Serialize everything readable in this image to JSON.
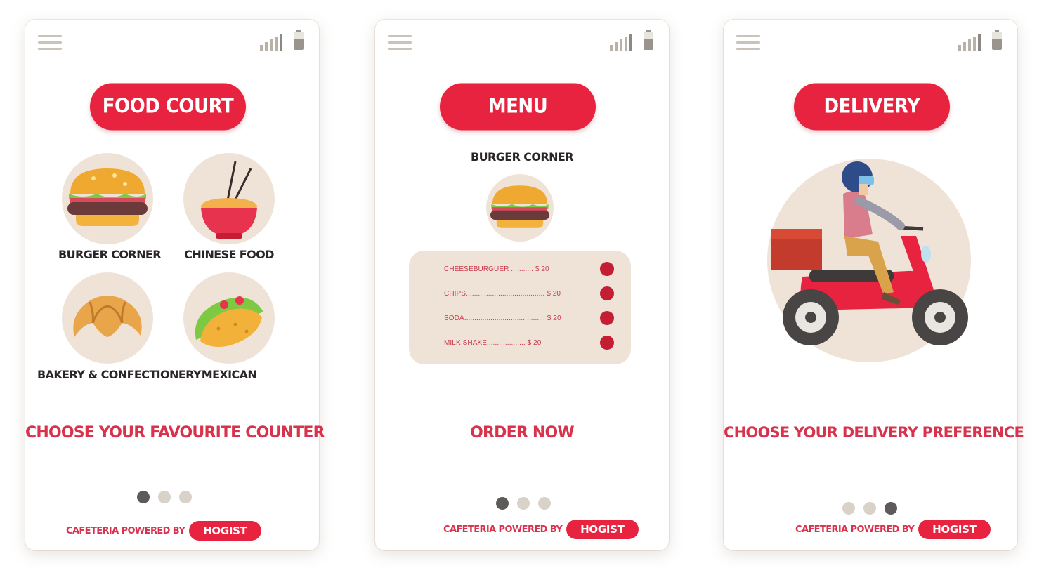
{
  "screens": [
    {
      "title": "FOOD COURT",
      "counters": [
        {
          "label": "BURGER CORNER",
          "icon": "burger-icon"
        },
        {
          "label": "CHINESE FOOD",
          "icon": "noodle-bowl-icon"
        },
        {
          "label": "BAKERY & CONFECTIONERY",
          "icon": "croissant-icon"
        },
        {
          "label": "MEXICAN",
          "icon": "taco-icon"
        }
      ],
      "tagline": "CHOOSE YOUR FAVOURITE COUNTER",
      "active_dot": 1
    },
    {
      "title": "MENU",
      "counter_name": "BURGER CORNER",
      "menu_items": [
        {
          "name": "CHEESEBURGUER",
          "leader": "CHEESEBURGUER ........... $ 20"
        },
        {
          "name": "CHIPS",
          "leader": "CHIPS....................................... $ 20"
        },
        {
          "name": "SODA",
          "leader": "SODA........................................ $ 20"
        },
        {
          "name": "MILK SHAKE",
          "leader": "MILK SHAKE................... $ 20"
        }
      ],
      "tagline": "ORDER NOW",
      "active_dot": 1
    },
    {
      "title": "DELIVERY",
      "tagline": "CHOOSE YOUR DELIVERY PREFERENCE",
      "active_dot": 3
    }
  ],
  "footer": {
    "powered_by": "CAFETERIA POWERED BY",
    "brand": "HOGIST"
  },
  "colors": {
    "accent": "#e8233f",
    "tagline": "#d8334d",
    "circle": "#efe3d8",
    "dot_active": "#5f5a5a",
    "dot_inactive": "#d8d2c9"
  },
  "icons": {
    "menu": "hamburger-menu-icon",
    "signal": "signal-strength-icon",
    "battery": "battery-icon",
    "delivery": "scooter-delivery-rider-illustration"
  }
}
